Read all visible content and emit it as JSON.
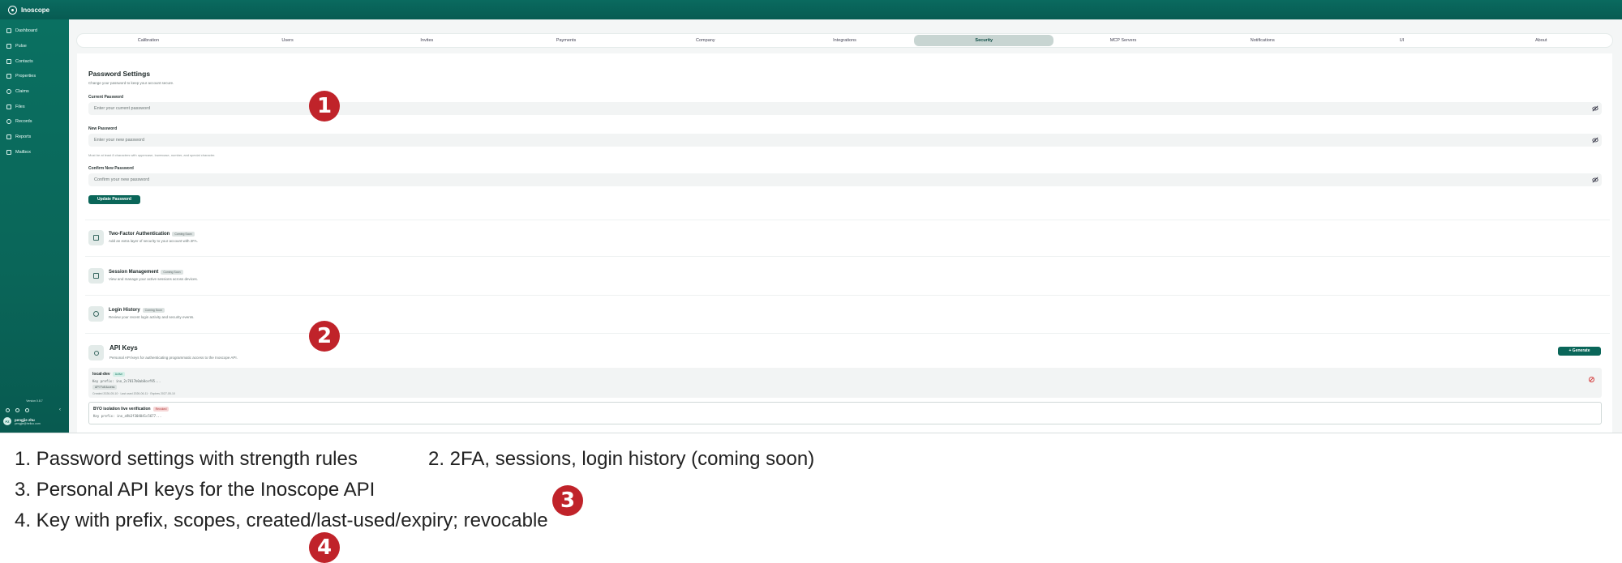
{
  "app": {
    "name": "Inoscope"
  },
  "sidebar": {
    "items": [
      {
        "label": "Dashboard",
        "icon": "grid-icon"
      },
      {
        "label": "Pulse",
        "icon": "pulse-icon"
      },
      {
        "label": "Contacts",
        "icon": "contacts-icon"
      },
      {
        "label": "Properties",
        "icon": "home-icon"
      },
      {
        "label": "Claims",
        "icon": "shield-icon"
      },
      {
        "label": "Files",
        "icon": "folder-icon"
      },
      {
        "label": "Records",
        "icon": "mic-icon"
      },
      {
        "label": "Reports",
        "icon": "report-icon"
      },
      {
        "label": "Mailbox",
        "icon": "mail-icon"
      }
    ],
    "version": "Version 0.8.7",
    "user": {
      "initials": "PZ",
      "name": "pengjie zhu",
      "email": "pengjie@helloo.com"
    }
  },
  "tabs": {
    "items": [
      {
        "label": "Calibration"
      },
      {
        "label": "Users"
      },
      {
        "label": "Invites"
      },
      {
        "label": "Payments"
      },
      {
        "label": "Company"
      },
      {
        "label": "Integrations"
      },
      {
        "label": "Security"
      },
      {
        "label": "MCP Servers"
      },
      {
        "label": "Notifications"
      },
      {
        "label": "UI"
      },
      {
        "label": "About"
      }
    ],
    "active": "Security"
  },
  "password": {
    "title": "Password Settings",
    "subtitle": "Change your password to keep your account secure.",
    "current_label": "Current Password",
    "current_placeholder": "Enter your current password",
    "new_label": "New Password",
    "new_placeholder": "Enter your new password",
    "hint": "Must be at least 8 characters with uppercase, lowercase, number, and special character.",
    "confirm_label": "Confirm New Password",
    "confirm_placeholder": "Confirm your new password",
    "update_button": "Update Password"
  },
  "features": [
    {
      "title": "Two-Factor Authentication",
      "badge": "Coming Soon",
      "desc": "Add an extra layer of security to your account with 2FA."
    },
    {
      "title": "Session Management",
      "badge": "Coming Soon",
      "desc": "View and manage your active sessions across devices."
    },
    {
      "title": "Login History",
      "badge": "Coming Soon",
      "desc": "Review your recent login activity and security events."
    }
  ],
  "api_keys": {
    "title": "API Keys",
    "subtitle": "Personal API keys for authenticating programmatic access to the Inoscope API.",
    "generate_button": "+ Generate",
    "keys": [
      {
        "name": "local-dev",
        "status": "Active",
        "prefix": "Key prefix: ino_2c7817b0ab8cef95...",
        "scope": "API Full Access",
        "meta": "Created 2026-05-10 · Last used 2026-06-11 · Expires 2027-05-10"
      },
      {
        "name": "BYO isolation live verification",
        "status": "Revoked",
        "prefix": "Key prefix: ino_a9b3f304041c5677..."
      }
    ]
  },
  "captions": [
    "1. Password settings with strength rules",
    "2. 2FA, sessions, login history (coming soon)",
    "3. Personal API keys for the Inoscope API",
    "4. Key with prefix, scopes, created/last-used/expiry; revocable"
  ],
  "callouts": [
    "1",
    "2",
    "3",
    "4"
  ],
  "colors": {
    "brand": "#0a6659",
    "callout": "#c0232a"
  }
}
